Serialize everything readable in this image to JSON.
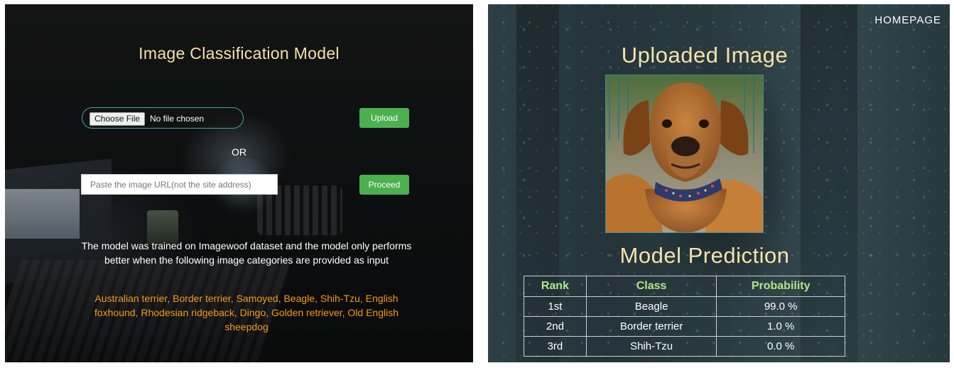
{
  "left": {
    "title": "Image Classification Model",
    "file_input": {
      "button_label": "Choose File",
      "status": "No file chosen"
    },
    "upload_label": "Upload",
    "or_label": "OR",
    "url_input": {
      "placeholder": "Paste the image URL(not the site address)",
      "value": ""
    },
    "proceed_label": "Proceed",
    "info": "The model was trained on Imagewoof dataset and the model only performs better when the following image categories are provided as input",
    "categories": "Australian terrier, Border terrier, Samoyed, Beagle, Shih-Tzu, English foxhound, Rhodesian ridgeback, Dingo, Golden retriever, Old English sheepdog"
  },
  "right": {
    "homepage_label": "HOMEPAGE",
    "uploaded_title": "Uploaded Image",
    "prediction_title": "Model Prediction",
    "table": {
      "headers": [
        "Rank",
        "Class",
        "Probability"
      ],
      "rows": [
        [
          "1st",
          "Beagle",
          "99.0 %"
        ],
        [
          "2nd",
          "Border terrier",
          "1.0 %"
        ],
        [
          "3rd",
          "Shih-Tzu",
          "0.0 %"
        ]
      ]
    }
  },
  "colors": {
    "title_gold": "#f3e2a8",
    "button_green": "#4caf50",
    "category_orange": "#f39c12",
    "table_header_green": "#aee88a",
    "pill_border_teal": "#3fa6a6"
  }
}
